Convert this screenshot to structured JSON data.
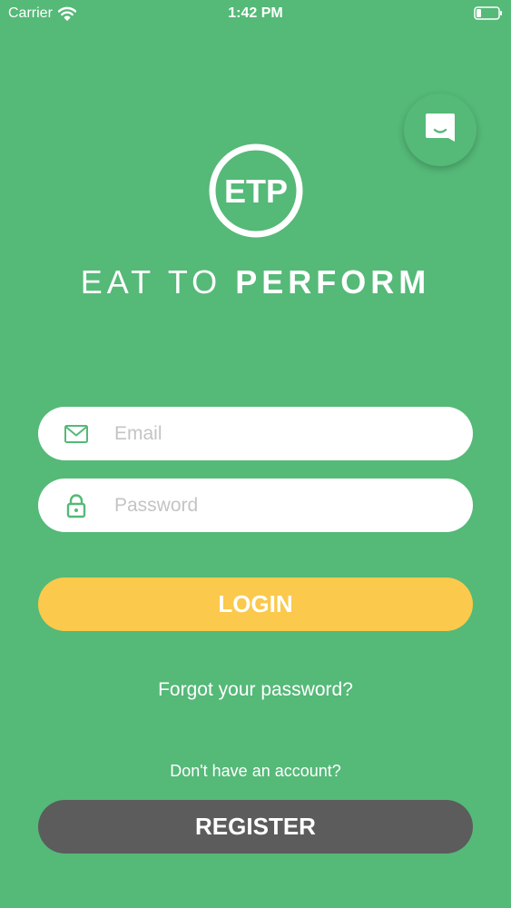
{
  "status_bar": {
    "carrier": "Carrier",
    "time": "1:42 PM",
    "wifi_icon": "wifi-icon",
    "battery_icon": "battery-icon"
  },
  "chat": {
    "icon": "chat-bubble-icon"
  },
  "logo": {
    "monogram": "ETP",
    "brand_light": "EAT TO",
    "brand_bold": "PERFORM"
  },
  "form": {
    "email": {
      "placeholder": "Email",
      "value": "",
      "icon": "mail-icon"
    },
    "password": {
      "placeholder": "Password",
      "value": "",
      "icon": "lock-icon"
    },
    "login_label": "LOGIN",
    "forgot_label": "Forgot your password?",
    "no_account_label": "Don't have an account?",
    "register_label": "REGISTER"
  },
  "colors": {
    "background": "#55b978",
    "login_button": "#fbc94b",
    "register_button": "#5c5c5c",
    "field_background": "#ffffff",
    "icon_accent": "#55b978"
  }
}
